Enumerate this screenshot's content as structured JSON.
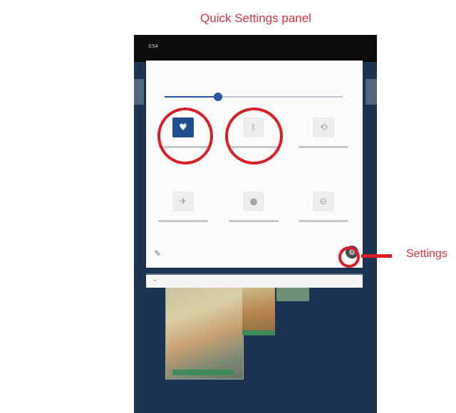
{
  "annotation": {
    "title": "Quick Settings panel",
    "settings_label": "Settings",
    "accent_color": "#d71f26"
  },
  "device": {
    "status_time": "3:54",
    "quick_settings": {
      "brightness_level_percent": 30,
      "tiles": [
        {
          "icon": "wifi-icon",
          "state": "on"
        },
        {
          "icon": "bluetooth-icon",
          "state": "off"
        },
        {
          "icon": "auto-rotate-icon",
          "state": "off"
        },
        {
          "icon": "airplane-mode-icon",
          "state": "off"
        },
        {
          "icon": "location-icon",
          "state": "off"
        },
        {
          "icon": "do-not-disturb-icon",
          "state": "off"
        }
      ],
      "footer": {
        "edit_icon": "pencil-icon",
        "settings_icon": "gear-icon"
      }
    },
    "notification": {
      "icon": "chevron-down-icon"
    }
  }
}
